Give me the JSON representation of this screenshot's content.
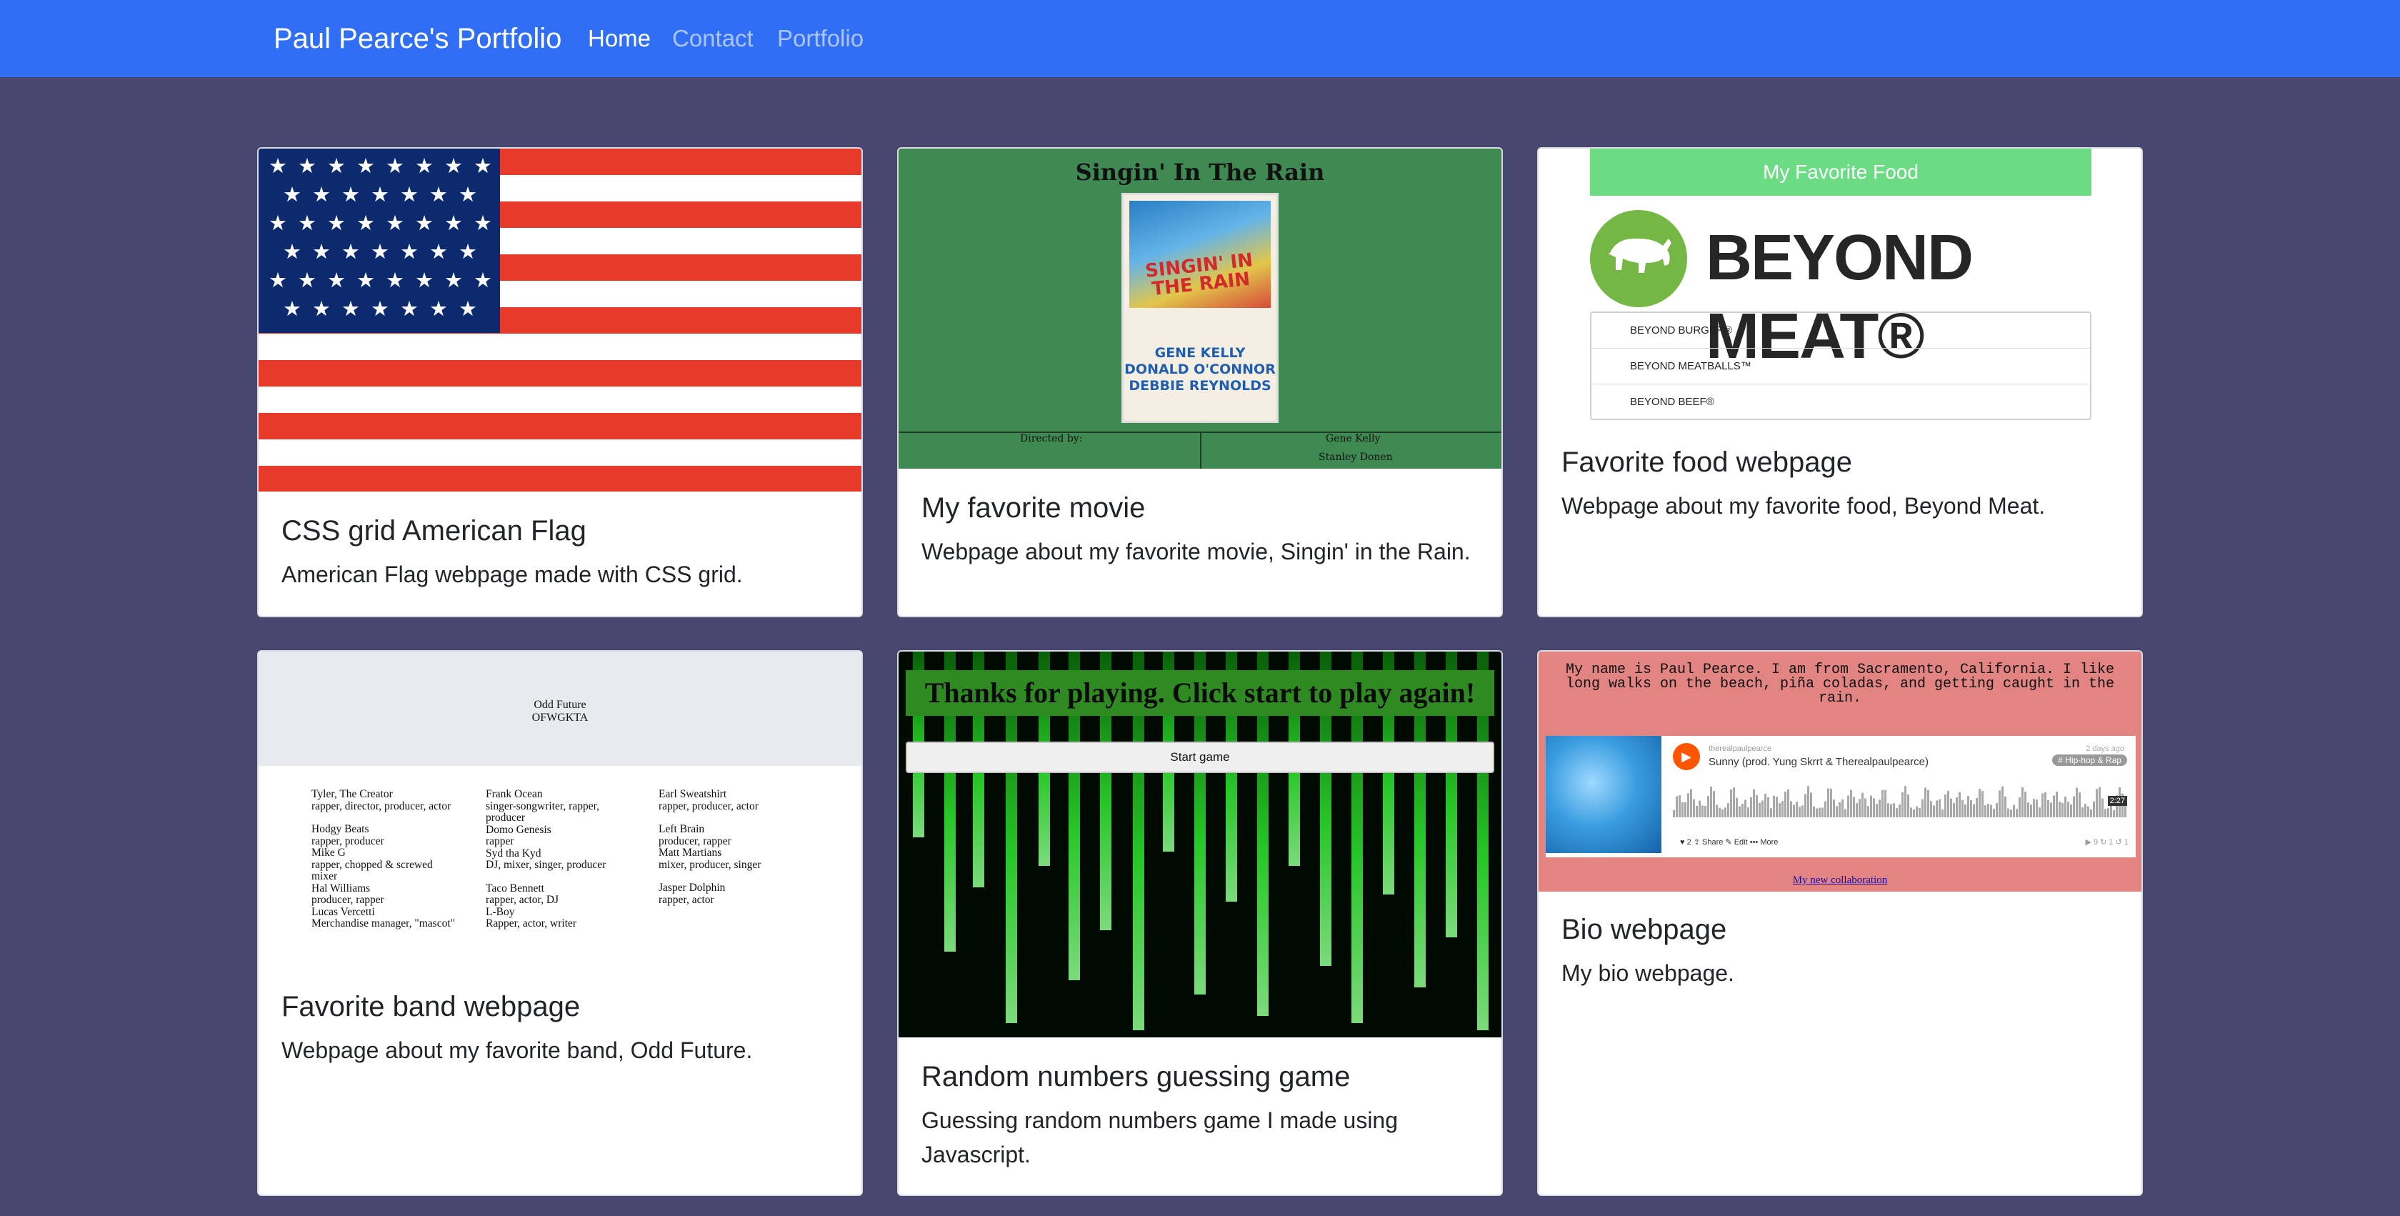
{
  "navbar": {
    "brand": "Paul Pearce's Portfolio",
    "links": [
      {
        "label": "Home",
        "active": true
      },
      {
        "label": "Contact",
        "active": false
      },
      {
        "label": "Portfolio",
        "active": false
      }
    ]
  },
  "colors": {
    "navbar": "#2f6ef5",
    "page_background": "#47476f"
  },
  "cards": [
    {
      "title": "CSS grid American Flag",
      "text": "American Flag webpage made with CSS grid.",
      "thumbnail": "american-flag"
    },
    {
      "title": "My favorite movie",
      "text": "Webpage about my favorite movie, Singin' in the Rain.",
      "thumbnail": "singin-in-the-rain-page",
      "preview": {
        "heading": "Singin' In The Rain",
        "poster_title": "SINGIN' IN THE RAIN",
        "poster_names": [
          "GENE KELLY",
          "DONALD O'CONNOR",
          "DEBBIE REYNOLDS"
        ],
        "directed_label": "Directed by:",
        "directors": [
          "Gene Kelly",
          "Stanley Donen"
        ]
      }
    },
    {
      "title": "Favorite food webpage",
      "text": "Webpage about my favorite food, Beyond Meat.",
      "thumbnail": "beyond-meat-page",
      "preview": {
        "banner": "My Favorite Food",
        "logo_text": "BEYOND MEAT®",
        "items": [
          "BEYOND BURGER®",
          "BEYOND MEATBALLS™",
          "BEYOND BEEF®"
        ]
      }
    },
    {
      "title": "Favorite band webpage",
      "text": "Webpage about my favorite band, Odd Future.",
      "thumbnail": "odd-future-page",
      "preview": {
        "header_line1": "Odd Future",
        "header_line2": "OFWGKTA",
        "columns": [
          [
            "Tyler, The Creator",
            "rapper, director, producer, actor",
            "",
            "Hodgy Beats",
            "rapper, producer",
            "Mike G",
            "rapper, chopped & screwed",
            "mixer",
            "Hal Williams",
            "producer, rapper",
            "Lucas Vercetti",
            "Merchandise manager, \"mascot\""
          ],
          [
            "Frank Ocean",
            "singer-songwriter, rapper,",
            "producer",
            "Domo Genesis",
            "rapper",
            "Syd tha Kyd",
            "DJ, mixer, singer, producer",
            "",
            "Taco Bennett",
            "rapper, actor, DJ",
            "L-Boy",
            "Rapper, actor, writer"
          ],
          [
            "Earl Sweatshirt",
            "rapper, producer, actor",
            "",
            "Left Brain",
            "producer, rapper",
            "Matt Martians",
            "mixer, producer, singer",
            "",
            "Jasper Dolphin",
            "rapper, actor"
          ]
        ]
      }
    },
    {
      "title": "Random numbers guessing game",
      "text": "Guessing random numbers game I made using Javascript.",
      "thumbnail": "matrix-guessing-game",
      "preview": {
        "banner": "Thanks for playing. Click start to play again!",
        "button": "Start game"
      }
    },
    {
      "title": "Bio webpage",
      "text": "My bio webpage.",
      "thumbnail": "bio-page",
      "preview": {
        "intro": "My name is Paul Pearce. I am from Sacramento, California. I like long walks on the beach, piña coladas, and getting caught in the rain.",
        "player_user": "therealpaulpearce",
        "player_track": "Sunny (prod. Yung Skrrt & Therealpaulpearce)",
        "player_date": "2 days ago",
        "player_tag": "# Hip-hop & Rap",
        "player_time": "2:27",
        "player_actions": "♥ 2    ⇪ Share    ✎ Edit    ••• More",
        "player_stats": "▶ 9   ↻ 1   ↺ 1",
        "link": "My new collaboration"
      }
    }
  ]
}
